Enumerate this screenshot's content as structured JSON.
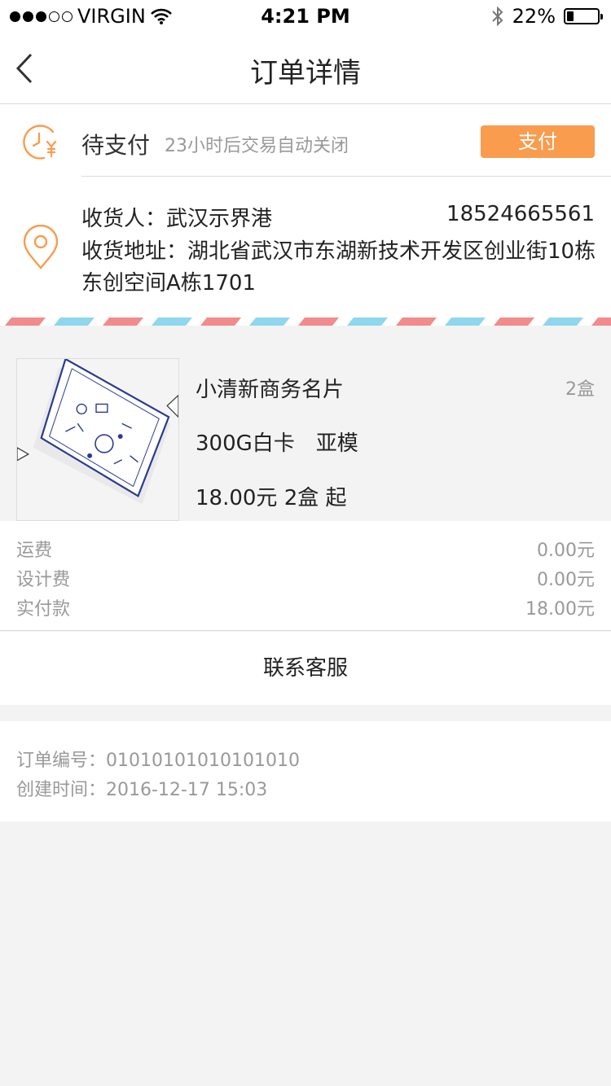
{
  "status_bar": {
    "carrier": "VIRGIN",
    "time": "4:21 PM",
    "battery": "22%",
    "signal_icon": "signal-dots-icon",
    "wifi_icon": "wifi-icon",
    "bluetooth_icon": "bluetooth-icon",
    "battery_level": 0.22
  },
  "nav": {
    "title": "订单详情",
    "back_icon": "chevron-left-icon"
  },
  "order_status": {
    "label": "待支付",
    "hint": "23小时后交易自动关闭",
    "pay_label": "支付",
    "icon": "clock-yuan-icon",
    "accent": "#f99c4e"
  },
  "address": {
    "icon": "location-pin-icon",
    "receiver": "收货人：武汉示界港",
    "phone": "18524665561",
    "address": "收货地址：湖北省武汉市东湖新技术开发区创业街10栋东创空间A栋1701"
  },
  "product": {
    "name": "小清新商务名片",
    "qty": "2盒",
    "spec": "300G白卡　亚模",
    "price": "18.00元 2盒 起"
  },
  "fees": [
    {
      "label": "运费",
      "value": "0.00元"
    },
    {
      "label": "设计费",
      "value": "0.00元"
    },
    {
      "label": "实付款",
      "value": "18.00元"
    }
  ],
  "contact": {
    "label": "联系客服"
  },
  "order_info": {
    "order_no": "订单编号：01010101010101010",
    "created": "创建时间：2016-12-17  15:03"
  },
  "colors": {
    "stripe_red": "#f28b8b",
    "stripe_blue": "#8fd6ee",
    "icon_orange": "#f99c4e"
  }
}
